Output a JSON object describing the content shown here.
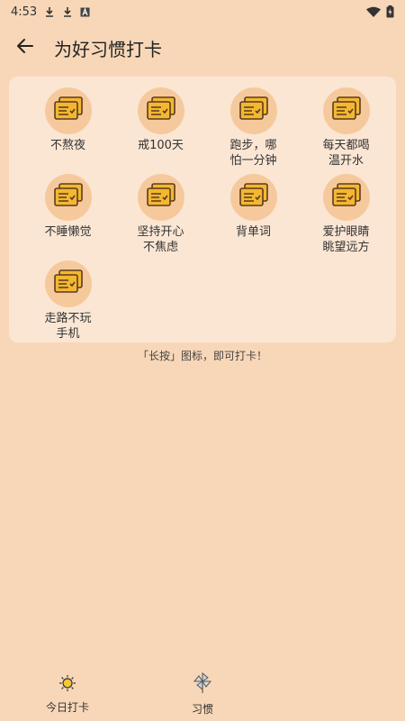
{
  "status": {
    "time": "4:53",
    "icons": [
      "download-icon",
      "download-icon",
      "a-badge-icon",
      "wifi-icon",
      "battery-icon"
    ]
  },
  "header": {
    "title": "为好习惯打卡",
    "back_icon": "arrow-left-icon"
  },
  "habits": [
    {
      "label": "不熬夜"
    },
    {
      "label": "戒100天"
    },
    {
      "label": "跑步，哪怕一分钟"
    },
    {
      "label": "每天都喝温开水"
    },
    {
      "label": "不睡懒觉"
    },
    {
      "label": "坚持开心不焦虑"
    },
    {
      "label": "背单词"
    },
    {
      "label": "爱护眼睛眺望远方"
    },
    {
      "label": "走路不玩手机"
    }
  ],
  "hint": "「长按」图标，即可打卡！",
  "nav": {
    "today_label": "今日打卡",
    "habits_label": "习惯"
  },
  "colors": {
    "background": "#f8d7b8",
    "card": "#fbe6d4",
    "icon_circle": "#f6c99c",
    "icon_card": "#f4b731"
  }
}
